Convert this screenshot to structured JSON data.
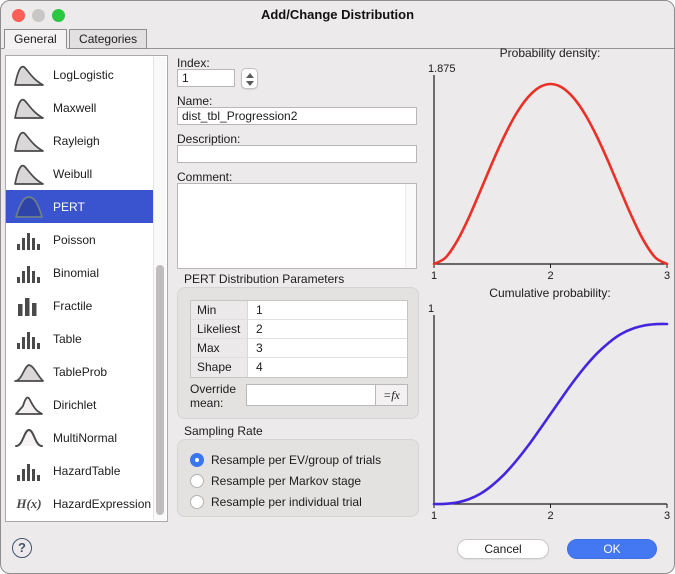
{
  "window": {
    "title": "Add/Change Distribution"
  },
  "tabs": [
    {
      "label": "General",
      "active": true
    },
    {
      "label": "Categories",
      "active": false
    }
  ],
  "sidebar": {
    "items": [
      {
        "label": "LogLogistic",
        "icon": "curve-skew",
        "selected": false
      },
      {
        "label": "Maxwell",
        "icon": "curve-skew",
        "selected": false
      },
      {
        "label": "Rayleigh",
        "icon": "curve-skew",
        "selected": false
      },
      {
        "label": "Weibull",
        "icon": "curve-skew",
        "selected": false
      },
      {
        "label": "PERT",
        "icon": "curve-bell",
        "selected": true
      },
      {
        "label": "Poisson",
        "icon": "bars",
        "selected": false
      },
      {
        "label": "Binomial",
        "icon": "bars",
        "selected": false
      },
      {
        "label": "Fractile",
        "icon": "bars-thick",
        "selected": false
      },
      {
        "label": "Table",
        "icon": "bars",
        "selected": false
      },
      {
        "label": "TableProb",
        "icon": "curve-wide",
        "selected": false
      },
      {
        "label": "Dirichlet",
        "icon": "curve-angular",
        "selected": false
      },
      {
        "label": "MultiNormal",
        "icon": "bell-outline",
        "selected": false
      },
      {
        "label": "HazardTable",
        "icon": "bars",
        "selected": false
      },
      {
        "label": "HazardExpression",
        "icon": "hx",
        "selected": false
      }
    ]
  },
  "form": {
    "index_label": "Index:",
    "index_value": "1",
    "name_label": "Name:",
    "name_value": "dist_tbl_Progression2",
    "description_label": "Description:",
    "description_value": "",
    "comment_label": "Comment:",
    "comment_value": "",
    "params_title": "PERT Distribution Parameters",
    "params_rows": [
      {
        "label": "Min",
        "value": "1"
      },
      {
        "label": "Likeliest",
        "value": "2"
      },
      {
        "label": "Max",
        "value": "3"
      },
      {
        "label": "Shape",
        "value": "4"
      }
    ],
    "override_label": "Override mean:",
    "override_value": "",
    "fx_label": "=fx",
    "sampling_title": "Sampling Rate",
    "sampling_options": [
      {
        "label": "Resample per EV/group of trials",
        "selected": true
      },
      {
        "label": "Resample per Markov stage",
        "selected": false
      },
      {
        "label": "Resample per individual trial",
        "selected": false
      }
    ]
  },
  "chart_data": [
    {
      "type": "line",
      "title": "Probability density:",
      "xlim": [
        1,
        3
      ],
      "ylim": [
        0,
        1.875
      ],
      "x_ticks": [
        1,
        2,
        3
      ],
      "y_top_label": "1.875",
      "color": "#e93128",
      "x": [
        1,
        1.1,
        1.2,
        1.3,
        1.4,
        1.5,
        1.6,
        1.7,
        1.8,
        1.9,
        2,
        2.1,
        2.2,
        2.3,
        2.4,
        2.5,
        2.6,
        2.7,
        2.8,
        2.9,
        3
      ],
      "y": [
        0,
        0.068,
        0.243,
        0.488,
        0.768,
        1.055,
        1.323,
        1.553,
        1.728,
        1.838,
        1.875,
        1.838,
        1.728,
        1.553,
        1.323,
        1.055,
        0.768,
        0.488,
        0.243,
        0.068,
        0
      ]
    },
    {
      "type": "line",
      "title": "Cumulative probability:",
      "xlim": [
        1,
        3
      ],
      "ylim": [
        0,
        1
      ],
      "x_ticks": [
        1,
        2,
        3
      ],
      "y_top_label": "1",
      "color": "#4526de",
      "x": [
        1,
        1.1,
        1.2,
        1.3,
        1.4,
        1.5,
        1.6,
        1.7,
        1.8,
        1.9,
        2,
        2.1,
        2.2,
        2.3,
        2.4,
        2.5,
        2.6,
        2.7,
        2.8,
        2.9,
        3
      ],
      "y": [
        0,
        0.001,
        0.009,
        0.027,
        0.058,
        0.104,
        0.163,
        0.235,
        0.317,
        0.407,
        0.5,
        0.593,
        0.683,
        0.765,
        0.837,
        0.896,
        0.942,
        0.973,
        0.991,
        0.999,
        1
      ]
    }
  ],
  "footer": {
    "help_label": "?",
    "cancel_label": "Cancel",
    "ok_label": "OK"
  },
  "colors": {
    "selection_blue": "#3a53cf",
    "ok_blue": "#4478f2",
    "radio_blue": "#3b76f1",
    "pdf_red": "#e93128",
    "cdf_blue": "#4526de"
  }
}
